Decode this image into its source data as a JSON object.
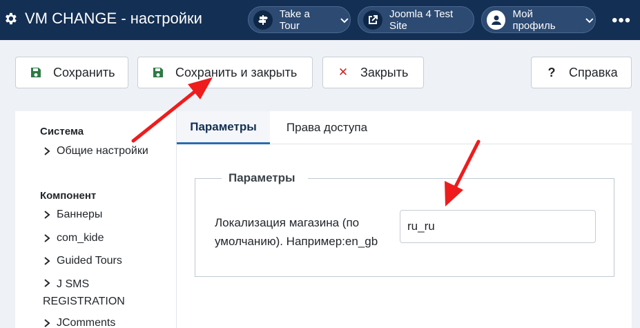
{
  "header": {
    "title": "VM CHANGE - настройки",
    "pills": [
      {
        "label": "Take a Tour",
        "icon": "signpost-icon"
      },
      {
        "label": "Joomla 4 Test Site",
        "icon": "external-link-icon"
      },
      {
        "label": "Мой профиль",
        "icon": "user-icon"
      }
    ],
    "more": "•••"
  },
  "toolbar": {
    "save_label": "Сохранить",
    "save_close_label": "Сохранить и закрыть",
    "close_label": "Закрыть",
    "help_label": "Справка",
    "help_icon_glyph": "?",
    "close_icon_glyph": "✕"
  },
  "sidebar": {
    "groups": [
      {
        "heading": "Система",
        "items": [
          "Общие настройки"
        ]
      },
      {
        "heading": "Компонент",
        "items": [
          "Баннеры",
          "com_kide",
          "Guided Tours",
          "J SMS REGISTRATION",
          "JComments"
        ]
      }
    ]
  },
  "tabs": [
    {
      "label": "Параметры",
      "active": true
    },
    {
      "label": "Права доступа",
      "active": false
    }
  ],
  "fieldset": {
    "legend": "Параметры",
    "field_label": "Локализация магазина (по умолчанию). Например:en_gb",
    "field_value": "ru_ru"
  },
  "colors": {
    "header_bg": "#132f53",
    "save_icon": "#2d7a45",
    "close_icon": "#c52827",
    "annotation_arrow": "#ee1c1c",
    "active_tab_border": "#2a6bb0"
  }
}
